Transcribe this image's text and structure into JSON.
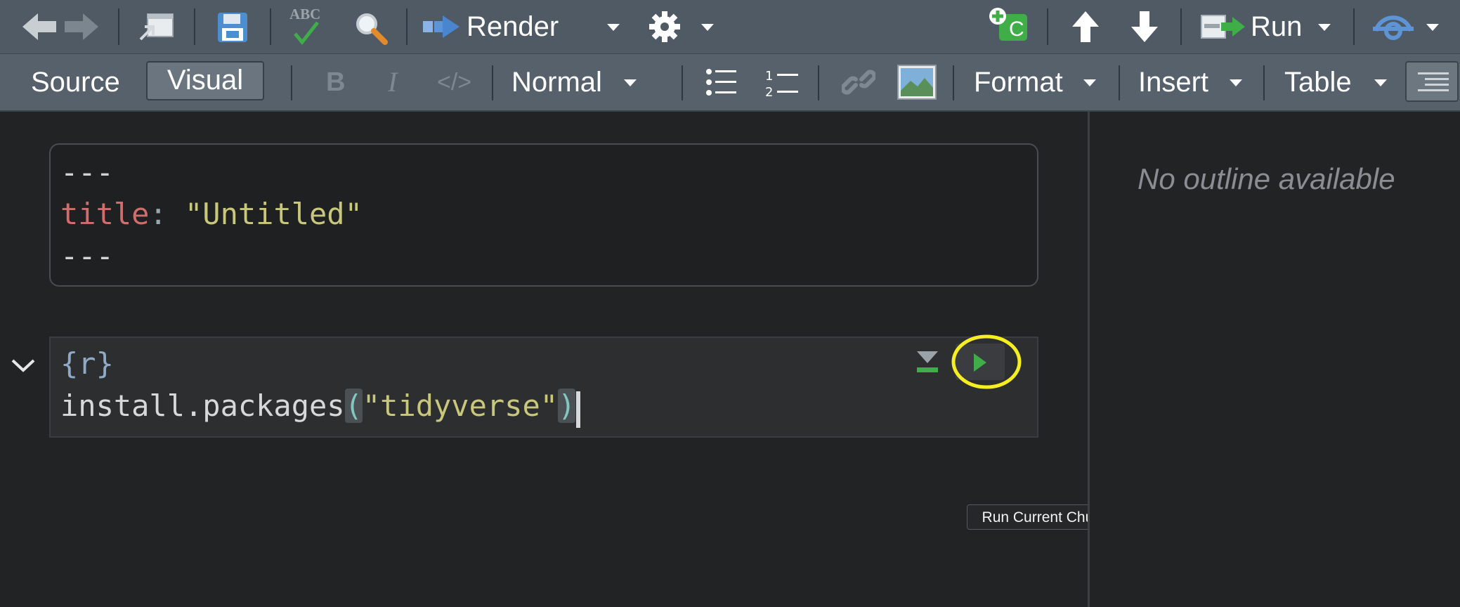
{
  "toolbar_main": {
    "render_label": "Render",
    "run_label": "Run",
    "spellcheck_text": "ABC",
    "chunk_insert_letter": "C"
  },
  "toolbar_format": {
    "source_label": "Source",
    "visual_label": "Visual",
    "bold_label": "B",
    "italic_label": "I",
    "code_label": "</>",
    "style_select_value": "Normal",
    "format_menu_label": "Format",
    "insert_menu_label": "Insert",
    "table_menu_label": "Table"
  },
  "editor": {
    "yaml": {
      "delimiter_top": "---",
      "key": "title",
      "colon": ":",
      "value": " \"Untitled\"",
      "delimiter_bottom": "---"
    },
    "chunk": {
      "header": "{r}",
      "code_fn": "install.packages",
      "code_open": "(",
      "code_arg": "\"tidyverse\"",
      "code_close": ")"
    },
    "tooltip": "Run Current Chunk"
  },
  "outline": {
    "empty_text": "No outline available"
  },
  "colors": {
    "toolbar_bg": "#4f5a65",
    "editor_bg": "#222325",
    "yaml_key": "#d06d6d",
    "string": "#c8c77b",
    "chunk_header": "#8fa9c6",
    "run_green": "#3fae49",
    "highlight_circle": "#f5ee22"
  }
}
